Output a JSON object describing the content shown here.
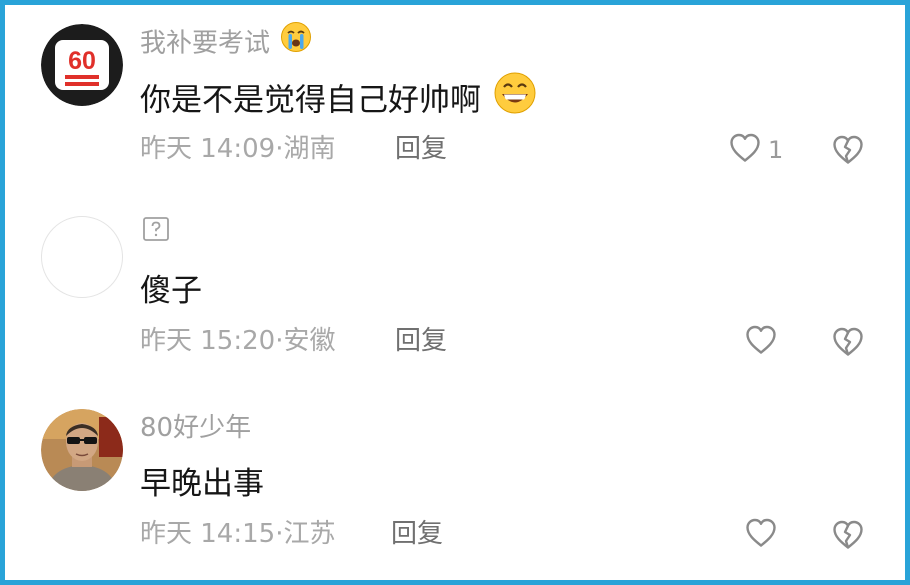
{
  "colors": {
    "frame": "#29a3d8",
    "username": "#a0a0a0",
    "content": "#161616",
    "meta": "#a8a8a8",
    "reply": "#707070",
    "icon": "#8a8a8a"
  },
  "comments": [
    {
      "username": "我补要考试",
      "username_emoji": "crying-face-emoji",
      "avatar": "60-hundred-points-avatar",
      "avatar_text": "60",
      "content": "你是不是觉得自己好帅啊",
      "content_emoji": "grinning-face-emoji",
      "time": "昨天 14:09",
      "separator": "·",
      "location": "湖南",
      "reply_label": "回复",
      "like_count": "1"
    },
    {
      "username": "",
      "username_icon": "missing-image-icon",
      "avatar": "blank-avatar",
      "content": "傻子",
      "time": "昨天 15:20",
      "separator": "·",
      "location": "安徽",
      "reply_label": "回复",
      "like_count": ""
    },
    {
      "username": "80好少年",
      "avatar": "man-with-sunglasses-avatar",
      "content": "早晚出事",
      "time": "昨天 14:15",
      "separator": "·",
      "location": "江苏",
      "reply_label": "回复",
      "like_count": ""
    }
  ]
}
